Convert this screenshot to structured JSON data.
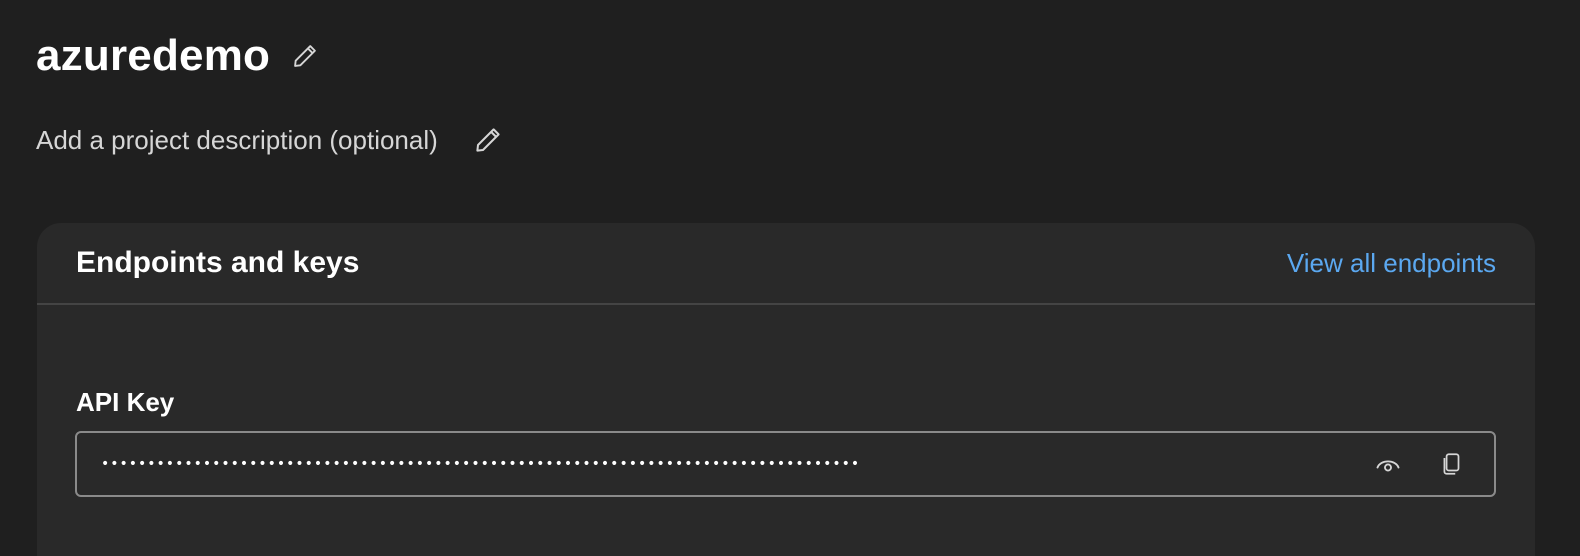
{
  "project": {
    "title": "azuredemo",
    "edit_icon": "pencil-icon",
    "description_placeholder": "Add a project description (optional)"
  },
  "endpoints_card": {
    "title": "Endpoints and keys",
    "view_all_link": "View all endpoints",
    "api_key": {
      "label": "API Key",
      "masked_value": "••••••••••••••••••••••••••••••••••••••••••••••••••••••••••••••••••••••••••••••••••",
      "show_icon": "eye-icon",
      "copy_icon": "copy-icon"
    }
  },
  "colors": {
    "background": "#1f1f1f",
    "card": "#292929",
    "link": "#5ba8f0",
    "field_border": "#8a8a8a"
  }
}
